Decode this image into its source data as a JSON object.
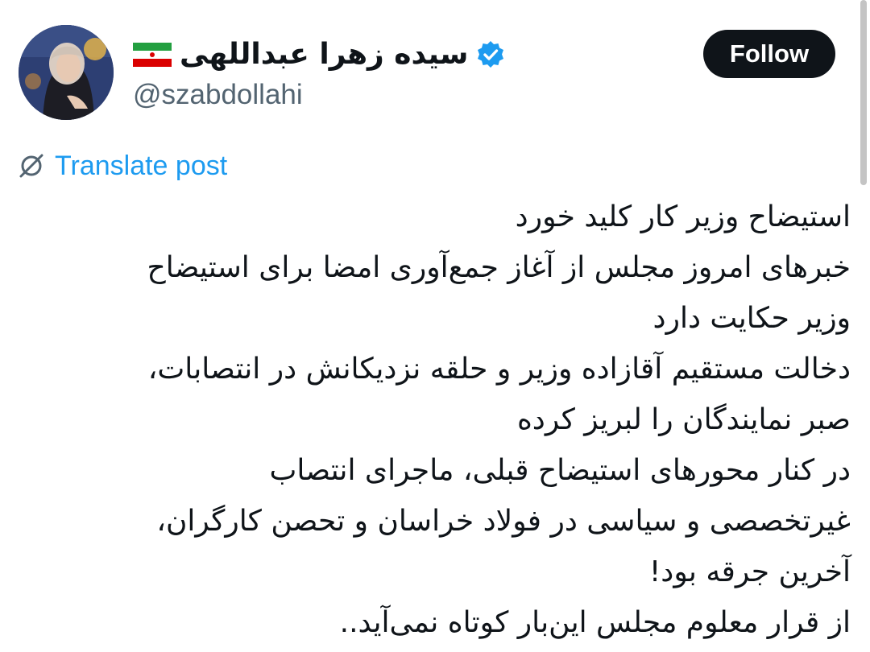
{
  "author": {
    "display_name": "سیده زهرا عبداللهی",
    "handle": "@szabdollahi",
    "verified": true,
    "flag_icon": "iran-flag-icon",
    "avatar_icon": "profile-photo-avatar"
  },
  "follow_label": "Follow",
  "translate_label": "Translate post",
  "post_lines": [
    "استیضاح وزیر کار کلید خورد",
    "خبرهای امروز مجلس از آغاز جمع‌آوری امضا برای استیضاح",
    "وزیر حکایت دارد",
    "دخالت مستقیم آقازاده وزیر و حلقه نزدیکانش در انتصابات،",
    "صبر نمایندگان را لبریز کرده",
    "در کنار محورهای استیضاح قبلی، ماجرای انتصاب",
    "غیرتخصصی و سیاسی در فولاد خراسان و تحصن کارگران،",
    "آخرین جرقه بود!",
    "از قرار معلوم مجلس این‌بار کوتاه نمی‌آید.."
  ],
  "colors": {
    "accent": "#1d9bf0",
    "text_primary": "#0f1419",
    "text_secondary": "#536471",
    "follow_bg": "#0f1419",
    "follow_text": "#ffffff",
    "background": "#ffffff"
  }
}
